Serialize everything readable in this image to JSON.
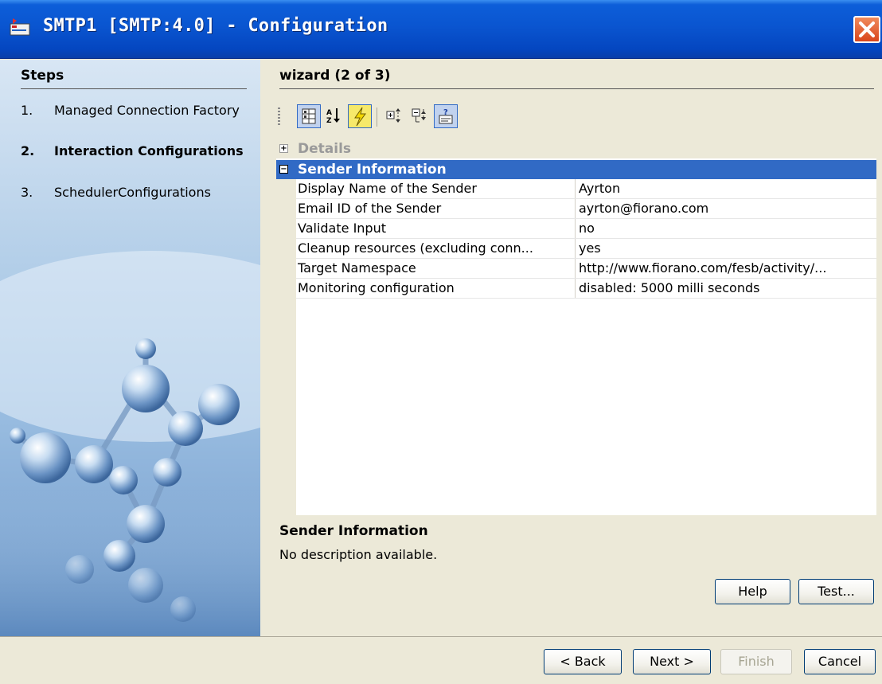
{
  "window": {
    "title": "SMTP1 [SMTP:4.0] - Configuration"
  },
  "steps": {
    "title": "Steps",
    "items": [
      {
        "num": "1.",
        "label": "Managed Connection Factory",
        "active": false
      },
      {
        "num": "2.",
        "label": "Interaction Configurations",
        "active": true
      },
      {
        "num": "3.",
        "label": "SchedulerConfigurations",
        "active": false
      }
    ]
  },
  "wizard": {
    "title": "wizard (2 of 3)"
  },
  "toolbar": {
    "icons": [
      "categorized-view-icon",
      "sort-alphabetical-icon",
      "lightning-icon",
      "expand-all-icon",
      "collapse-all-icon",
      "show-description-icon"
    ]
  },
  "sheet": {
    "categories": [
      {
        "label": "Details",
        "expanded": false,
        "toggle": "+"
      },
      {
        "label": "Sender Information",
        "expanded": true,
        "toggle": "−"
      }
    ],
    "properties": [
      {
        "name": "Display Name of the Sender",
        "value": "Ayrton"
      },
      {
        "name": "Email ID of the Sender",
        "value": "ayrton@fiorano.com"
      },
      {
        "name": "Validate Input",
        "value": "no"
      },
      {
        "name": "Cleanup resources (excluding conn...",
        "value": "yes"
      },
      {
        "name": "Target Namespace",
        "value": "http://www.fiorano.com/fesb/activity/..."
      },
      {
        "name": "Monitoring configuration",
        "value": "disabled: 5000 milli seconds"
      }
    ]
  },
  "description": {
    "title": "Sender Information",
    "text": "No description available."
  },
  "buttons": {
    "help": "Help",
    "test": "Test...",
    "back": "< Back",
    "next": "Next >",
    "finish": "Finish",
    "cancel": "Cancel"
  },
  "colors": {
    "titlebar": "#0a55d0",
    "selection": "#316ac5",
    "dialog_bg": "#ece9d8",
    "close_button": "#d9461c"
  }
}
